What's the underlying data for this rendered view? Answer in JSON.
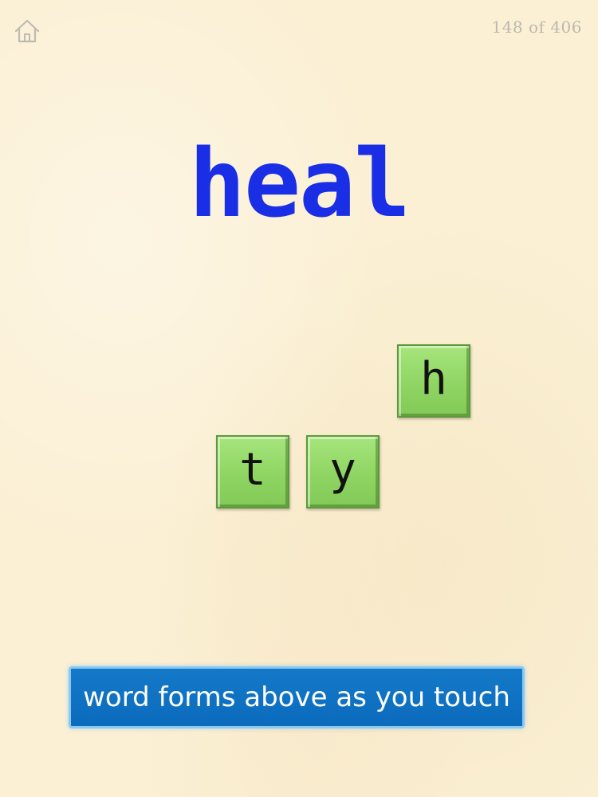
{
  "header": {
    "home_icon": "home-icon",
    "counter": "148 of 406"
  },
  "word": {
    "text": "heal",
    "color": "#1a2ee6"
  },
  "tiles": [
    {
      "letter": "h"
    },
    {
      "letter": "t"
    },
    {
      "letter": "y"
    }
  ],
  "tile_color": "#8fd563",
  "hint": {
    "text": "word forms above as you touch",
    "color": "#0b6bbd"
  }
}
